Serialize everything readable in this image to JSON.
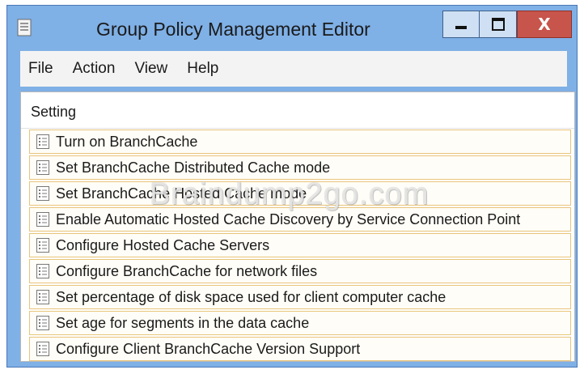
{
  "window": {
    "title": "Group Policy Management Editor",
    "buttons": {
      "minimize": "minimize-icon",
      "maximize": "maximize-icon",
      "close": "X"
    },
    "colors": {
      "frame": "#7fb0e6",
      "close_button": "#c7554c",
      "row_border": "#e8c47a"
    }
  },
  "menu": {
    "items": [
      "File",
      "Action",
      "View",
      "Help"
    ]
  },
  "list": {
    "column_header": "Setting",
    "row_icon": "policy-setting-icon",
    "rows": [
      "Turn on BranchCache",
      "Set BranchCache Distributed Cache mode",
      "Set BranchCache Hosted Cache mode",
      "Enable Automatic Hosted Cache Discovery by Service Connection Point",
      "Configure Hosted Cache Servers",
      "Configure BranchCache for network files",
      "Set percentage of disk space used for client computer cache",
      "Set age for segments in the data cache",
      "Configure Client BranchCache Version Support"
    ]
  },
  "watermark": "Braindump2go.com"
}
